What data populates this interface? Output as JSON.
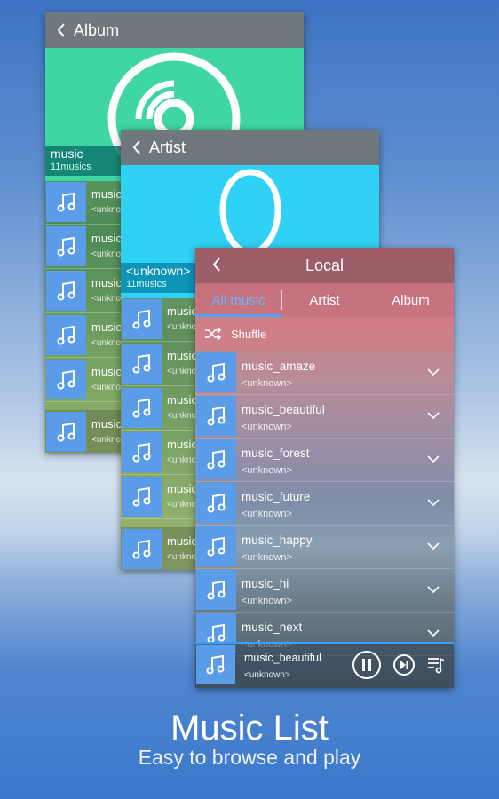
{
  "album_panel": {
    "title": "Album",
    "cover_label": "music",
    "cover_count": "11musics",
    "rows": [
      {
        "title": "music",
        "artist": "<unknown>"
      },
      {
        "title": "music",
        "artist": "<unknown>"
      },
      {
        "title": "music",
        "artist": "<unknown>"
      },
      {
        "title": "music",
        "artist": "<unknown>"
      },
      {
        "title": "music",
        "artist": "<unknown>"
      }
    ],
    "mini_title": "music",
    "mini_artist": "<unknown>"
  },
  "artist_panel": {
    "title": "Artist",
    "cover_label": "<unknown>",
    "cover_count": "11musics",
    "rows": [
      {
        "title": "music",
        "artist": "<unknown>"
      },
      {
        "title": "music",
        "artist": "<unknown>"
      },
      {
        "title": "music",
        "artist": "<unknown>"
      },
      {
        "title": "music",
        "artist": "<unknown>"
      },
      {
        "title": "music",
        "artist": "<unknown>"
      }
    ],
    "mini_title": "music",
    "mini_artist": "<unknown>"
  },
  "local_panel": {
    "title": "Local",
    "tabs": [
      "All music",
      "Artist",
      "Album"
    ],
    "active_tab": "All music",
    "shuffle_label": "Shuffle",
    "songs": [
      {
        "title": "music_amaze",
        "artist": "<unknown>"
      },
      {
        "title": "music_beautiful",
        "artist": "<unknown>"
      },
      {
        "title": "music_forest",
        "artist": "<unknown>"
      },
      {
        "title": "music_future",
        "artist": "<unknown>"
      },
      {
        "title": "music_happy",
        "artist": "<unknown>"
      },
      {
        "title": "music_hi",
        "artist": "<unknown>"
      },
      {
        "title": "music_next",
        "artist": "<unknown>"
      }
    ],
    "now_playing": {
      "title": "music_beautiful",
      "artist": "<unknown>"
    }
  },
  "headline": "Music List",
  "subline": "Easy to browse and play",
  "colors": {
    "album_cover": "#3fd6a2",
    "artist_cover": "#2fd2f5",
    "thumb": "#5b9ce8",
    "accent": "#3aa0ff"
  }
}
